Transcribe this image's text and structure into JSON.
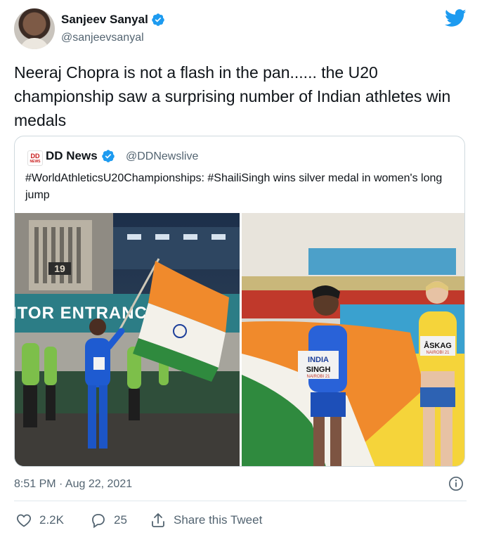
{
  "author": {
    "name": "Sanjeev Sanyal",
    "handle": "@sanjeevsanyal",
    "avatar_icon": "profile-photo",
    "verified_icon": "verified-badge-icon"
  },
  "brand_icon": "twitter-bird-icon",
  "tweet": {
    "text": "Neeraj Chopra is not a flash in the pan...... the U20 championship saw a surprising number of Indian athletes win medals"
  },
  "quoted_tweet": {
    "logo_text": "DD",
    "logo_subtext": "NEWS",
    "name": "DD News",
    "handle": "@DDNewslive",
    "text": "#WorldAthleticsU20Championships: #ShailiSingh wins silver medal in women's long jump",
    "photos": {
      "left": {
        "stadium_number": "19",
        "banner_text": "ITOR ENTRANC"
      },
      "right": {
        "bib_country": "INDIA",
        "bib_name": "SINGH",
        "bib_event": "NAIROBI 21",
        "bib2_name": "ÅSKAG",
        "bib2_event": "NAIROBI 21"
      }
    }
  },
  "meta": {
    "timestamp": "8:51 PM · Aug 22, 2021"
  },
  "actions": {
    "likes": "2.2K",
    "replies": "25",
    "share_label": "Share this Tweet"
  },
  "colors": {
    "twitter_blue": "#1d9bf0",
    "text_primary": "#0f1419",
    "text_secondary": "#536471",
    "border": "#cfd9de"
  }
}
